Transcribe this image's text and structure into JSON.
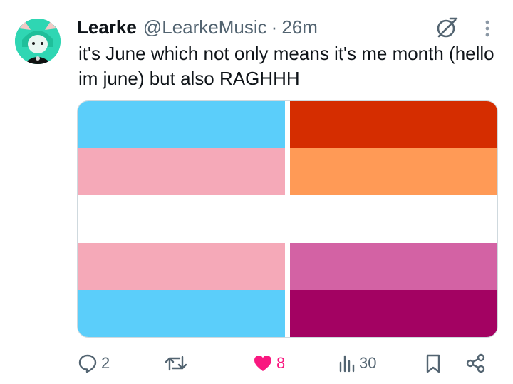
{
  "tweet": {
    "author_name": "Learke",
    "author_handle": "@LearkeMusic",
    "separator": "·",
    "timestamp": "26m",
    "text": "it's June which not only means it's me month (hello im june) but also RAGHHH"
  },
  "media": {
    "flags": [
      {
        "name": "transgender-flag",
        "stripes": [
          "#5bcefa",
          "#f5a9b8",
          "#ffffff",
          "#f5a9b8",
          "#5bcefa"
        ]
      },
      {
        "name": "lesbian-flag",
        "stripes": [
          "#d52d00",
          "#ff9a56",
          "#ffffff",
          "#d362a4",
          "#a30262"
        ]
      }
    ]
  },
  "actions": {
    "reply_count": "2",
    "repost_count": "",
    "like_count": "8",
    "views_count": "30"
  },
  "icons": {
    "grok": "grok-icon",
    "more": "more-icon",
    "reply": "reply-icon",
    "repost": "repost-icon",
    "like": "heart-icon",
    "views": "views-icon",
    "bookmark": "bookmark-icon",
    "share": "share-icon"
  },
  "colors": {
    "like_active": "#f91880",
    "secondary_text": "#536471",
    "avatar_bg": "#2fd6b3"
  }
}
